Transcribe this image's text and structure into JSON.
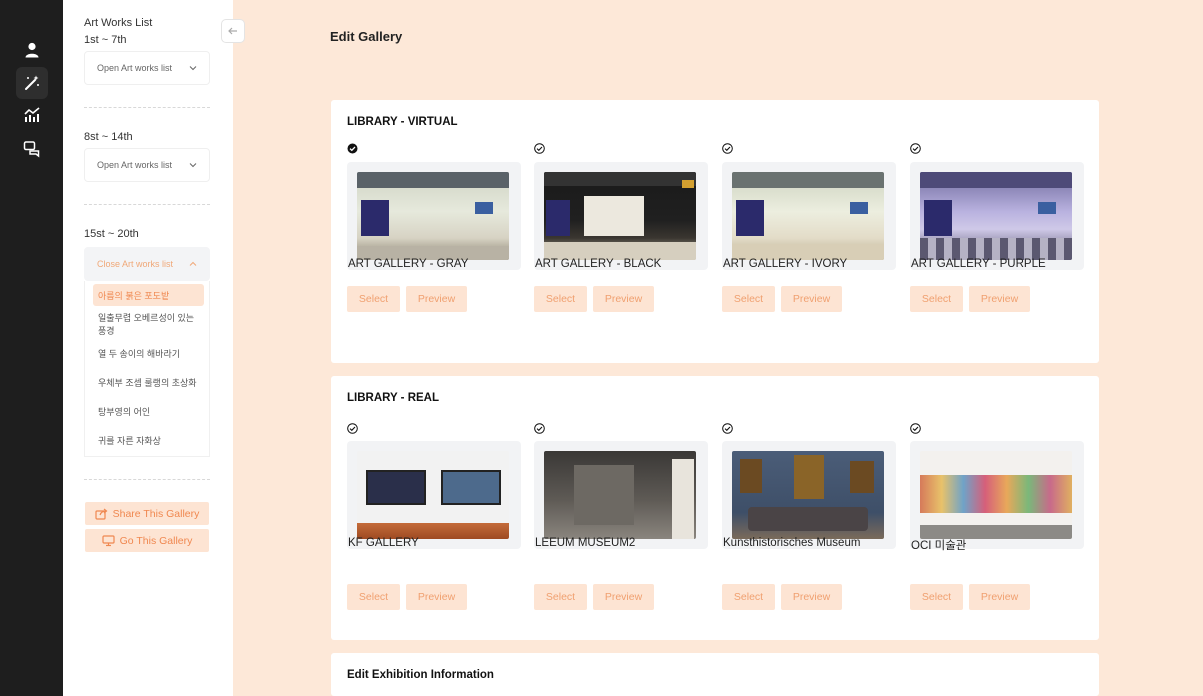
{
  "nav": {
    "icons": [
      "user-icon",
      "magic-wand-icon",
      "analytics-icon",
      "chat-icon"
    ],
    "active_index": 1
  },
  "panel": {
    "heading": "Art Works List",
    "groups": [
      {
        "range": "1st ~ 7th",
        "select_label": "Open Art works list"
      },
      {
        "range": "8st ~ 14th",
        "select_label": "Open Art works list"
      },
      {
        "range": "15st ~ 20th",
        "select_label": "Close Art works list"
      }
    ],
    "dropdown_items": [
      "아름의 붉은 포도밭",
      "일출무렵 오베르성이 있는 풍경",
      "열 두 송이의 해바라기",
      "우체부 조셉 룰랭의 초상화",
      "탕부영의 어인",
      "귀를 자른 자화상"
    ],
    "active_item": 0,
    "share_button": "Share This Gallery",
    "go_button": "Go This Gallery"
  },
  "main": {
    "title": "Edit Gallery",
    "virtual": {
      "title": "LIBRARY - VIRTUAL",
      "cards": [
        {
          "name": "ART GALLERY - GRAY",
          "selected": true
        },
        {
          "name": "ART GALLERY - BLACK",
          "selected": false
        },
        {
          "name": "ART GALLERY - IVORY",
          "selected": false
        },
        {
          "name": "ART GALLERY - PURPLE",
          "selected": false
        }
      ]
    },
    "real": {
      "title": "LIBRARY - REAL",
      "cards": [
        {
          "name": "KF GALLERY",
          "selected": false
        },
        {
          "name": "LEEUM MUSEUM2",
          "selected": false
        },
        {
          "name": "Kunsthistorisches Museum",
          "selected": false
        },
        {
          "name": "OCI 미술관",
          "selected": false
        }
      ]
    },
    "select_label": "Select",
    "preview_label": "Preview",
    "exhibition": {
      "title": "Edit Exhibition Information"
    }
  },
  "colors": {
    "accent": "#f08850",
    "accent_light": "#fde4d3",
    "page_bg": "#fde8d8",
    "rail_bg": "#1e1e1e"
  }
}
